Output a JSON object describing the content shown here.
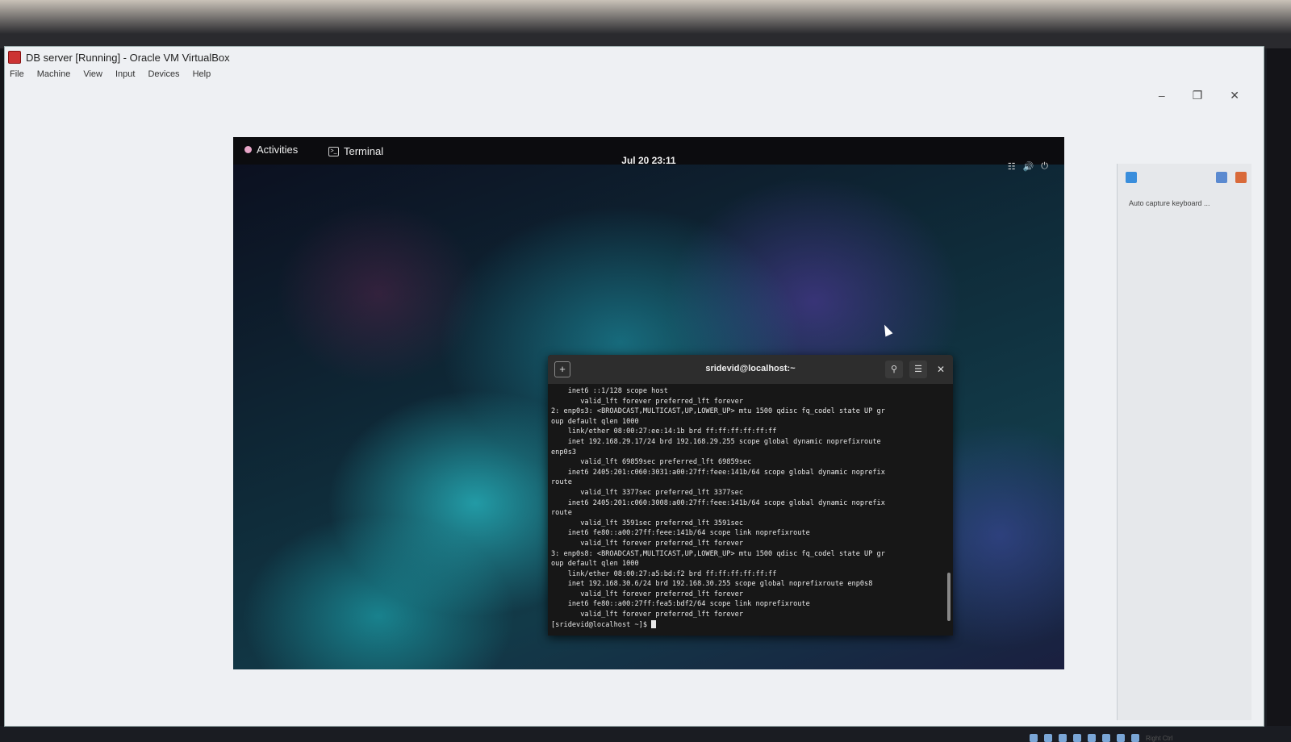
{
  "window": {
    "title": "DB server [Running] - Oracle VM VirtualBox",
    "menu": [
      "File",
      "Machine",
      "View",
      "Input",
      "Devices",
      "Help"
    ],
    "controls": [
      "minimize",
      "restore",
      "close"
    ]
  },
  "gnome": {
    "activities": "Activities",
    "app": "Terminal",
    "clock": "Jul 20  23:11",
    "tray_icons": [
      "network-icon",
      "volume-icon",
      "power-icon"
    ]
  },
  "terminal": {
    "title": "sridevid@localhost:~",
    "lines": [
      "    inet6 ::1/128 scope host",
      "       valid_lft forever preferred_lft forever",
      "2: enp0s3: <BROADCAST,MULTICAST,UP,LOWER_UP> mtu 1500 qdisc fq_codel state UP gr",
      "oup default qlen 1000",
      "    link/ether 08:00:27:ee:14:1b brd ff:ff:ff:ff:ff:ff",
      "    inet 192.168.29.17/24 brd 192.168.29.255 scope global dynamic noprefixroute",
      "enp0s3",
      "       valid_lft 69859sec preferred_lft 69859sec",
      "    inet6 2405:201:c060:3031:a00:27ff:feee:141b/64 scope global dynamic noprefix",
      "route",
      "       valid_lft 3377sec preferred_lft 3377sec",
      "    inet6 2405:201:c060:3008:a00:27ff:feee:141b/64 scope global dynamic noprefix",
      "route",
      "       valid_lft 3591sec preferred_lft 3591sec",
      "    inet6 fe80::a00:27ff:feee:141b/64 scope link noprefixroute",
      "       valid_lft forever preferred_lft forever",
      "3: enp0s8: <BROADCAST,MULTICAST,UP,LOWER_UP> mtu 1500 qdisc fq_codel state UP gr",
      "oup default qlen 1000",
      "    link/ether 08:00:27:a5:bd:f2 brd ff:ff:ff:ff:ff:ff",
      "    inet 192.168.30.6/24 brd 192.168.30.255 scope global noprefixroute enp0s8",
      "       valid_lft forever preferred_lft forever",
      "    inet6 fe80::a00:27ff:fea5:bdf2/64 scope link noprefixroute",
      "       valid_lft forever preferred_lft forever"
    ],
    "prompt": "[sridevid@localhost ~]$ "
  },
  "side_panel": {
    "label": "Auto capture keyboard ..."
  },
  "status_bar": {
    "host_key": "Right Ctrl"
  }
}
